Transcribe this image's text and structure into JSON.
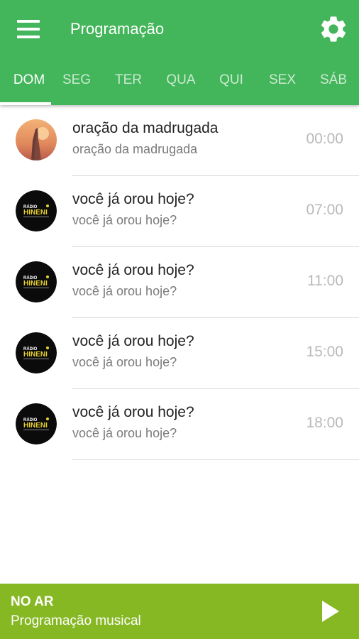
{
  "header": {
    "title": "Programação",
    "menu_icon": "menu-icon",
    "settings_icon": "gear-icon"
  },
  "tabs": [
    {
      "label": "DOM",
      "active": true
    },
    {
      "label": "SEG",
      "active": false
    },
    {
      "label": "TER",
      "active": false
    },
    {
      "label": "QUA",
      "active": false
    },
    {
      "label": "QUI",
      "active": false
    },
    {
      "label": "SEX",
      "active": false
    },
    {
      "label": "SÁB",
      "active": false
    }
  ],
  "schedule": [
    {
      "title": "oração da madrugada",
      "subtitle": "oração da madrugada",
      "time": "00:00",
      "image": "praying-hands-sunset"
    },
    {
      "title": "você já orou hoje?",
      "subtitle": "você já orou hoje?",
      "time": "07:00",
      "image": "radio-hineni-logo"
    },
    {
      "title": "você já orou hoje?",
      "subtitle": "você já orou hoje?",
      "time": "11:00",
      "image": "radio-hineni-logo"
    },
    {
      "title": "você já orou hoje?",
      "subtitle": "você já orou hoje?",
      "time": "15:00",
      "image": "radio-hineni-logo"
    },
    {
      "title": "você já orou hoje?",
      "subtitle": "você já orou hoje?",
      "time": "18:00",
      "image": "radio-hineni-logo"
    }
  ],
  "logo_text": {
    "line1": "RÁDIO",
    "line2": "HINENI"
  },
  "now_playing": {
    "label": "NO AR",
    "program": "Programação musical",
    "play_icon": "play-icon"
  },
  "colors": {
    "header": "#43b55a",
    "now_bar": "#86b824",
    "time_text": "#b9b9b9"
  }
}
